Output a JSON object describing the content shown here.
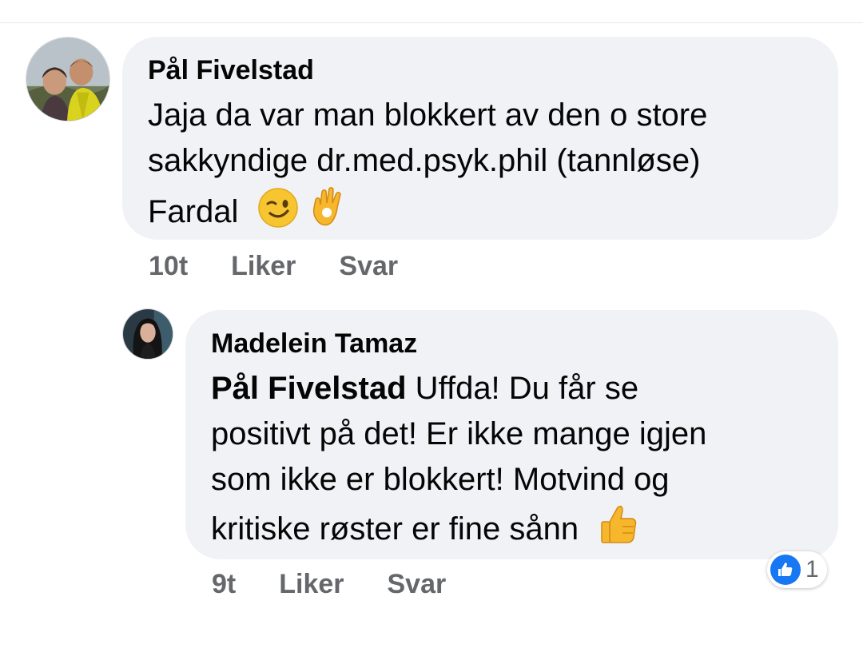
{
  "comments": [
    {
      "author": "Pål Fivelstad",
      "text_lines": [
        "Jaja da var man blokkert av den o store",
        "sakkyndige dr.med.psyk.phil (tannløse)",
        "Fardal"
      ],
      "emojis": [
        "winking-face",
        "ok-hand"
      ],
      "time": "10t",
      "like_label": "Liker",
      "reply_label": "Svar"
    },
    {
      "author": "Madelein Tamaz",
      "mention": "Pål Fivelstad",
      "text_first": " Uffda! Du får se",
      "text_lines": [
        "positivt på det! Er ikke mange igjen",
        "som ikke er blokkert! Motvind og",
        "kritiske røster er fine sånn"
      ],
      "emojis": [
        "thumbs-up"
      ],
      "time": "9t",
      "like_label": "Liker",
      "reply_label": "Svar",
      "reaction_count": "1",
      "reaction_type": "like"
    }
  ],
  "colors": {
    "bubble": "#f0f2f5",
    "meta": "#65676b",
    "like_blue": "#1877f2",
    "text": "#050505"
  }
}
